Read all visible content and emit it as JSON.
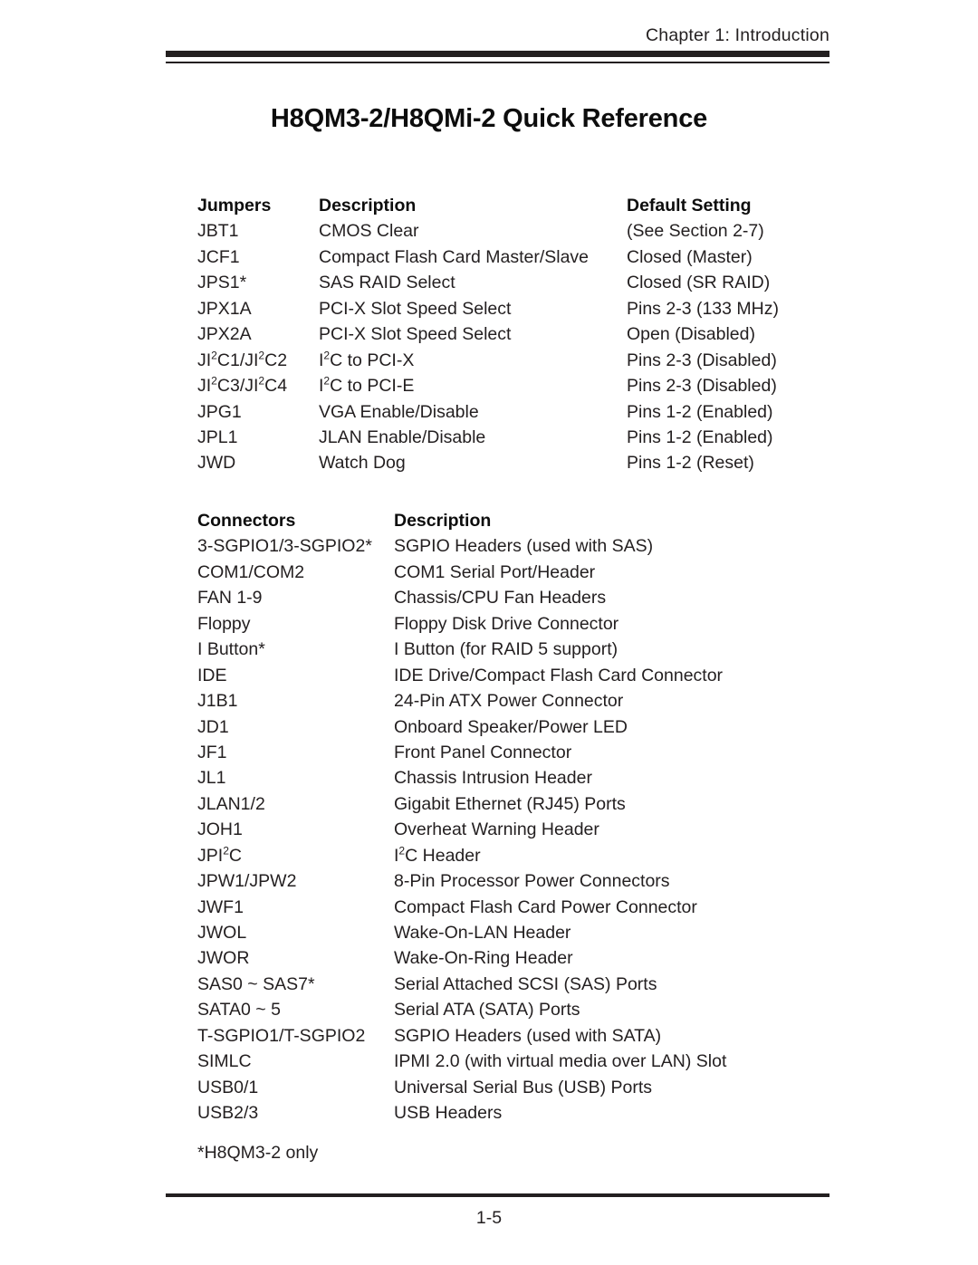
{
  "header": {
    "running_head": "Chapter 1: Introduction"
  },
  "title": "H8QM3-2/H8QMi-2 Quick Reference",
  "jumpers_table": {
    "headers": {
      "col0": "Jumpers",
      "col1": "Description",
      "col2": "Default Setting"
    },
    "rows": [
      {
        "jumper": "JBT1",
        "description": "CMOS Clear",
        "default": "(See Section 2-7)"
      },
      {
        "jumper": "JCF1",
        "description": "Compact Flash Card Master/Slave",
        "default": "Closed (Master)"
      },
      {
        "jumper": "JPS1*",
        "description": "SAS RAID Select",
        "default": "Closed (SR RAID)"
      },
      {
        "jumper": "JPX1A",
        "description": "PCI-X Slot Speed Select",
        "default": "Pins 2-3 (133 MHz)"
      },
      {
        "jumper": "JPX2A",
        "description": "PCI-X Slot Speed Select",
        "default": "Open (Disabled)"
      },
      {
        "jumper": "JI2C1/JI2C2",
        "jumper_html": "JI<sup>2</sup>C1/JI<sup>2</sup>C2",
        "description": "I2C to PCI-X",
        "description_html": "I<sup>2</sup>C to PCI-X",
        "default": "Pins 2-3 (Disabled)"
      },
      {
        "jumper": "JI2C3/JI2C4",
        "jumper_html": "JI<sup>2</sup>C3/JI<sup>2</sup>C4",
        "description": "I2C to PCI-E",
        "description_html": "I<sup>2</sup>C to PCI-E",
        "default": "Pins 2-3 (Disabled)"
      },
      {
        "jumper": "JPG1",
        "description": "VGA Enable/Disable",
        "default": "Pins 1-2 (Enabled)"
      },
      {
        "jumper": "JPL1",
        "description": "JLAN Enable/Disable",
        "default": "Pins 1-2 (Enabled)"
      },
      {
        "jumper": "JWD",
        "description": "Watch Dog",
        "default": "Pins 1-2 (Reset)"
      }
    ]
  },
  "connectors_table": {
    "headers": {
      "col0": "Connectors",
      "col1": "Description"
    },
    "rows": [
      {
        "connector": "3-SGPIO1/3-SGPIO2*",
        "description": "SGPIO Headers (used with SAS)"
      },
      {
        "connector": "COM1/COM2",
        "description": "COM1 Serial Port/Header"
      },
      {
        "connector": "FAN 1-9",
        "description": "Chassis/CPU Fan Headers"
      },
      {
        "connector": "Floppy",
        "description": "Floppy Disk Drive Connector"
      },
      {
        "connector": "I Button*",
        "description": "I Button (for RAID 5 support)"
      },
      {
        "connector": "IDE",
        "description": "IDE Drive/Compact Flash Card Connector"
      },
      {
        "connector": "J1B1",
        "description": "24-Pin ATX Power Connector"
      },
      {
        "connector": "JD1",
        "description": "Onboard Speaker/Power LED"
      },
      {
        "connector": "JF1",
        "description": "Front Panel Connector"
      },
      {
        "connector": "JL1",
        "description": "Chassis Intrusion Header"
      },
      {
        "connector": "JLAN1/2",
        "description": "Gigabit Ethernet (RJ45) Ports"
      },
      {
        "connector": "JOH1",
        "description": "Overheat Warning Header"
      },
      {
        "connector": "JPI2C",
        "connector_html": "JPI<sup>2</sup>C",
        "description": "I2C Header",
        "description_html": "I<sup>2</sup>C Header"
      },
      {
        "connector": "JPW1/JPW2",
        "description": "8-Pin Processor Power Connectors"
      },
      {
        "connector": "JWF1",
        "description": "Compact Flash Card Power Connector"
      },
      {
        "connector": "JWOL",
        "description": "Wake-On-LAN Header"
      },
      {
        "connector": "JWOR",
        "description": "Wake-On-Ring Header"
      },
      {
        "connector": "SAS0 ~ SAS7*",
        "description": "Serial Attached SCSI (SAS) Ports"
      },
      {
        "connector": "SATA0 ~ 5",
        "description": "Serial ATA (SATA) Ports"
      },
      {
        "connector": "T-SGPIO1/T-SGPIO2",
        "description": "SGPIO Headers (used with SATA)"
      },
      {
        "connector": "SIMLC",
        "description": "IPMI 2.0 (with virtual media over LAN) Slot"
      },
      {
        "connector": "USB0/1",
        "description": "Universal Serial Bus (USB) Ports"
      },
      {
        "connector": "USB2/3",
        "description": "USB Headers"
      }
    ]
  },
  "footnote": "*H8QM3-2 only",
  "footer": {
    "page_number": "1-5"
  }
}
